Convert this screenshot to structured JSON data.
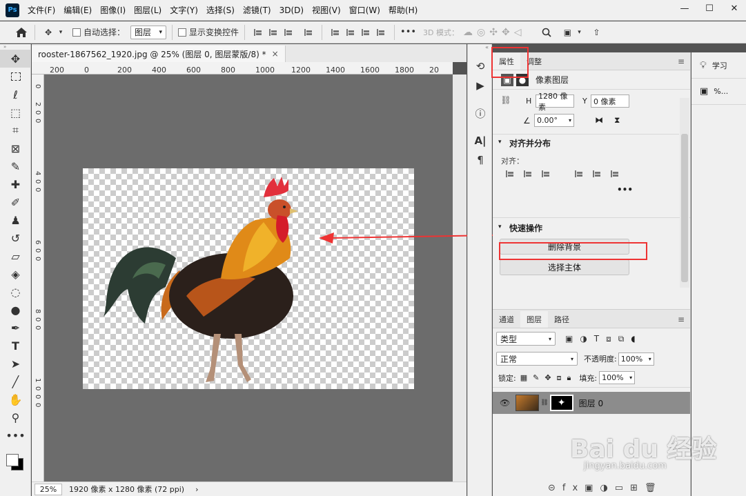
{
  "app": {
    "logo": "Ps"
  },
  "menu": [
    "文件(F)",
    "编辑(E)",
    "图像(I)",
    "图层(L)",
    "文字(Y)",
    "选择(S)",
    "滤镜(T)",
    "3D(D)",
    "视图(V)",
    "窗口(W)",
    "帮助(H)"
  ],
  "window_controls": {
    "minimize": "—",
    "maximize": "☐",
    "close": "✕"
  },
  "options": {
    "auto_select_label": "自动选择：",
    "auto_select_value": "图层",
    "show_transform_label": "显示变换控件",
    "mode_3d_label": "3D 模式：",
    "more": "•••"
  },
  "document": {
    "tab_title": "rooster-1867562_1920.jpg @ 25% (图层 0, 图层蒙版/8) *",
    "close": "×"
  },
  "ruler": {
    "h": [
      "200",
      "0",
      "200",
      "400",
      "600",
      "800",
      "1000",
      "1200",
      "1400",
      "1600",
      "1800",
      "20"
    ],
    "v": [
      "0",
      "2",
      "0",
      "0",
      "4",
      "0",
      "0",
      "6",
      "0",
      "0",
      "8",
      "0",
      "0",
      "1",
      "0",
      "0",
      "0"
    ]
  },
  "status": {
    "zoom": "25%",
    "info": "1920 像素 x 1280 像素 (72 ppi)",
    "arrow": "›"
  },
  "properties": {
    "tab_properties": "属性",
    "tab_adjust": "调整",
    "layer_type": "像素图层",
    "h_label": "H",
    "h_value": "1280 像素",
    "y_label": "Y",
    "y_value": "0 像素",
    "angle_value": "0.00°",
    "align_section": "对齐并分布",
    "align_label": "对齐：",
    "more": "•••",
    "quick_section": "快速操作",
    "btn_remove_bg": "删除背景",
    "btn_select_subject": "选择主体"
  },
  "layers_panel": {
    "tabs": [
      "通道",
      "图层",
      "路径"
    ],
    "filter_kind": "类型",
    "blend_mode": "正常",
    "opacity_label": "不透明度:",
    "opacity_value": "100%",
    "lock_label": "锁定:",
    "fill_label": "填充:",
    "fill_value": "100%",
    "layer_name": "图层 0"
  },
  "learn_panel": {
    "learn": "学习",
    "percent": "%..."
  },
  "watermark": {
    "text": "Bai du 经验",
    "url": "jingyan.baidu.com"
  }
}
